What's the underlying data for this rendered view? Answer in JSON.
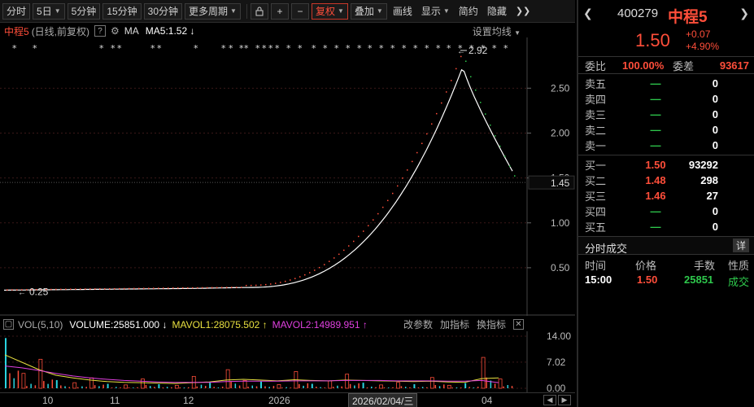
{
  "toolbar": {
    "tabs": [
      {
        "label": "分时",
        "dropdown": false,
        "active": false
      },
      {
        "label": "5日",
        "dropdown": true,
        "active": false
      },
      {
        "label": "5分钟",
        "dropdown": false,
        "active": false
      },
      {
        "label": "15分钟",
        "dropdown": false,
        "active": false
      },
      {
        "label": "30分钟",
        "dropdown": false,
        "active": false
      },
      {
        "label": "更多周期",
        "dropdown": true,
        "active": false
      }
    ],
    "lock_icon": "lock-icon",
    "zoom_in_icon": "plus-icon",
    "zoom_out_icon": "minus-icon",
    "adjust_label": "复权",
    "overlay_label": "叠加",
    "draw_label": "画线",
    "display_label": "显示",
    "simple_label": "简约",
    "hide_label": "隐藏",
    "expand_icon": "double-chevron-right-icon"
  },
  "chart_header": {
    "name": "中程5",
    "mode": "(日线,前复权)",
    "help": "?",
    "settings_icon": "gear-icon",
    "ma_label": "MA",
    "ma5": "MA5:1.52",
    "ma5_arrow": "↓",
    "setting_ma": "设置均线"
  },
  "price_axis": {
    "ticks": [
      "2.50",
      "2.00",
      "1.50",
      "1.00",
      "0.50"
    ],
    "current": "1.45"
  },
  "annotations": {
    "high": "2.92",
    "low": "0.25"
  },
  "volume_header": {
    "indicator": "VOL(5,10)",
    "volume": "VOLUME:25851.000",
    "volume_arrow": "↓",
    "mavol1": "MAVOL1:28075.502",
    "mavol1_arrow": "↑",
    "mavol2": "MAVOL2:14989.951",
    "mavol2_arrow": "↑",
    "edit_params": "改参数",
    "add_indicator": "加指标",
    "switch_indicator": "换指标"
  },
  "volume_axis": {
    "ticks": [
      "14.00",
      "7.02",
      "0.00"
    ]
  },
  "date_axis": {
    "labels": [
      "10",
      "11",
      "12",
      "2026",
      "04"
    ],
    "cursor": "2026/02/04/三"
  },
  "quote": {
    "code": "400279",
    "name": "中程5",
    "price": "1.50",
    "change": "+0.07",
    "change_pct": "+4.90%",
    "webi_label": "委比",
    "webi_value": "100.00%",
    "weicha_label": "委差",
    "weicha_value": "93617",
    "asks": [
      {
        "label": "卖五",
        "price": "—",
        "qty": "0"
      },
      {
        "label": "卖四",
        "price": "—",
        "qty": "0"
      },
      {
        "label": "卖三",
        "price": "—",
        "qty": "0"
      },
      {
        "label": "卖二",
        "price": "—",
        "qty": "0"
      },
      {
        "label": "卖一",
        "price": "—",
        "qty": "0"
      }
    ],
    "bids": [
      {
        "label": "买一",
        "price": "1.50",
        "qty": "93292"
      },
      {
        "label": "买二",
        "price": "1.48",
        "qty": "298"
      },
      {
        "label": "买三",
        "price": "1.46",
        "qty": "27"
      },
      {
        "label": "买四",
        "price": "—",
        "qty": "0"
      },
      {
        "label": "买五",
        "price": "—",
        "qty": "0"
      }
    ]
  },
  "trades": {
    "title": "分时成交",
    "detail_button": "详",
    "headers": [
      "时间",
      "价格",
      "手数",
      "性质"
    ],
    "rows": [
      {
        "time": "15:00",
        "price": "1.50",
        "volume": "25851",
        "nature": "成交"
      }
    ]
  },
  "colors": {
    "up": "#ff4e3a",
    "down": "#2ec84c",
    "ma_line": "#ffffff",
    "mavol1": "#e8e040",
    "mavol2": "#e040e0",
    "volume_bar": "#29d4e0"
  },
  "chart_data": [
    {
      "type": "line",
      "title": "中程5",
      "ylabel": "",
      "ylim": [
        0.2,
        2.9
      ],
      "series": [
        {
          "name": "MA5",
          "values": [
            0.25,
            0.25,
            0.26,
            0.26,
            0.27,
            0.28,
            0.3,
            0.36,
            0.45,
            0.58,
            0.72,
            0.85,
            1.05,
            1.35,
            1.75,
            2.15,
            2.55,
            2.75,
            2.6,
            2.1,
            1.7,
            1.52
          ]
        }
      ],
      "price_highlight": {
        "high": 2.92,
        "low": 0.25,
        "last": 1.45
      }
    },
    {
      "type": "bar",
      "title": "VOL(5,10)",
      "ylim": [
        0,
        14.0
      ],
      "series": [
        {
          "name": "VOLUME",
          "values": [
            13.5,
            4.0,
            7.8,
            2.2,
            1.5,
            2.8,
            1.2,
            0.9,
            2.5,
            1.1,
            0.8,
            3.2,
            1.5,
            5.0,
            2.1,
            1.8,
            1.0,
            4.5,
            1.2,
            2.0,
            3.8,
            1.5,
            0.9,
            1.6,
            1.1,
            2.9,
            0.8,
            1.4,
            8.3,
            2.5
          ]
        },
        {
          "name": "MAVOL1",
          "values": [
            9.0,
            7.0,
            5.0,
            3.5,
            2.8,
            2.2,
            1.8,
            1.6,
            1.5,
            1.4,
            1.3,
            1.5,
            1.7,
            2.2,
            2.4,
            2.2,
            2.0,
            2.3,
            2.1,
            2.0,
            2.2,
            2.1,
            2.0,
            1.9,
            1.8,
            1.9,
            1.7,
            1.6,
            2.6,
            2.8
          ]
        },
        {
          "name": "MAVOL2",
          "values": [
            6.0,
            5.5,
            4.8,
            4.0,
            3.3,
            2.8,
            2.4,
            2.1,
            1.9,
            1.7,
            1.6,
            1.6,
            1.6,
            1.8,
            1.9,
            1.9,
            1.9,
            2.0,
            2.0,
            2.0,
            2.1,
            2.1,
            2.1,
            2.0,
            2.0,
            2.0,
            1.9,
            1.9,
            2.1,
            1.5
          ]
        }
      ]
    }
  ]
}
